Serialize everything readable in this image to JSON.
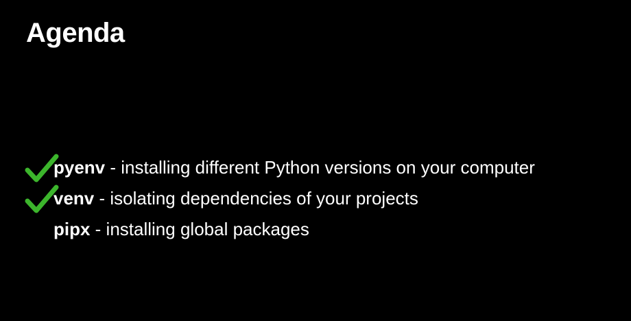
{
  "slide": {
    "title": "Agenda",
    "items": [
      {
        "tool": "pyenv",
        "description": " - installing different Python versions on your computer",
        "checked": true,
        "icon": "checkmark-icon"
      },
      {
        "tool": "venv",
        "description": " - isolating dependencies of your projects",
        "checked": true,
        "icon": "checkmark-icon"
      },
      {
        "tool": "pipx",
        "description": " - installing global packages",
        "checked": false,
        "icon": ""
      }
    ]
  },
  "colors": {
    "background": "#000000",
    "text": "#ffffff",
    "check": "#3cb52c"
  }
}
